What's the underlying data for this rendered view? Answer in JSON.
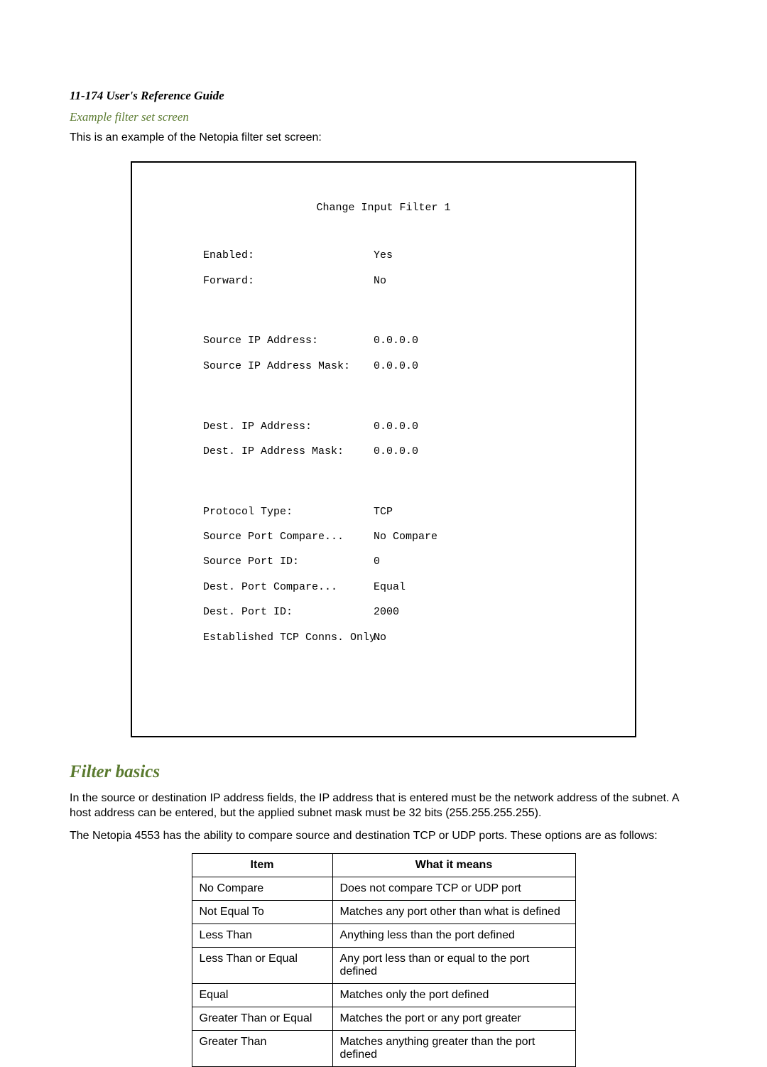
{
  "header": {
    "page_ref": "11-174  User's Reference Guide"
  },
  "example_section": {
    "title": "Example filter set screen",
    "intro": "This is an example of the Netopia filter set screen:"
  },
  "screen": {
    "title": "Change Input Filter 1",
    "rows": {
      "enabled_label": "Enabled:",
      "enabled_value": "Yes",
      "forward_label": "Forward:",
      "forward_value": "No",
      "src_ip_label": "Source IP Address:",
      "src_ip_value": "0.0.0.0",
      "src_mask_label": "Source IP Address Mask:",
      "src_mask_value": "0.0.0.0",
      "dst_ip_label": "Dest. IP Address:",
      "dst_ip_value": "0.0.0.0",
      "dst_mask_label": "Dest. IP Address Mask:",
      "dst_mask_value": "0.0.0.0",
      "proto_label": "Protocol Type:",
      "proto_value": "TCP",
      "spc_label": "Source Port Compare...",
      "spc_value": "No Compare",
      "spid_label": "Source Port ID:",
      "spid_value": "0",
      "dpc_label": "Dest. Port Compare...",
      "dpc_value": "Equal",
      "dpid_label": "Dest. Port ID:",
      "dpid_value": "2000",
      "est_label": "Established TCP Conns. Only:",
      "est_value": "No"
    }
  },
  "filter_basics": {
    "heading": "Filter basics",
    "para1": "In the source or destination IP address fields, the IP address that is entered must be the network address of the subnet. A host address can be entered, but the applied subnet mask must be 32 bits (255.255.255.255).",
    "para2": "The Netopia 4553 has the ability to compare source and destination TCP or UDP ports. These options are as follows:"
  },
  "table": {
    "headers": {
      "item": "Item",
      "desc": "What it means"
    },
    "rows": [
      {
        "item": "No Compare",
        "desc": "Does not compare TCP or UDP port"
      },
      {
        "item": "Not Equal To",
        "desc": "Matches any port other than what is defined"
      },
      {
        "item": "Less Than",
        "desc": "Anything less than the port defined"
      },
      {
        "item": "Less Than or Equal",
        "desc": "Any port less than or equal to the port defined"
      },
      {
        "item": "Equal",
        "desc": "Matches only the port defined"
      },
      {
        "item": "Greater Than or Equal",
        "desc": "Matches the port or any port greater"
      },
      {
        "item": "Greater Than",
        "desc": "Matches anything greater than the port defined"
      }
    ]
  }
}
